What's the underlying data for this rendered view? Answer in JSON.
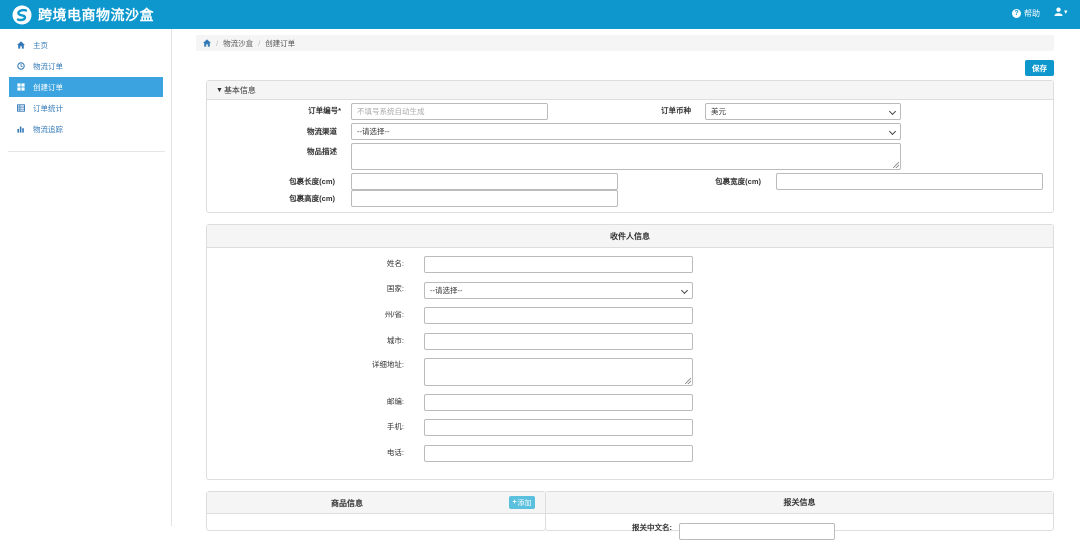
{
  "app": {
    "title": "跨境电商物流沙盒"
  },
  "header": {
    "help_label": "帮助",
    "user_caret": "▾"
  },
  "sidebar": {
    "items": [
      {
        "label": "主页"
      },
      {
        "label": "物流订单"
      },
      {
        "label": "创建订单"
      },
      {
        "label": "订单统计"
      },
      {
        "label": "物流追踪"
      }
    ]
  },
  "breadcrumb": {
    "level1": "物流沙盒",
    "level2": "创建订单",
    "separator": "/"
  },
  "toolbar": {
    "save_label": "保存"
  },
  "basic": {
    "title": "基本信息",
    "order_no_label": "订单编号*",
    "order_no_placeholder": "不填号系统自动生成",
    "currency_label": "订单币种",
    "currency_value": "美元",
    "channel_label": "物流渠道",
    "channel_value": "--请选择--",
    "desc_label": "物品描述",
    "length_label": "包裹长度(cm)",
    "width_label": "包裹宽度(cm)",
    "height_label": "包裹高度(cm)"
  },
  "recipient": {
    "title": "收件人信息",
    "name_label": "姓名:",
    "country_label": "国家:",
    "country_value": "--请选择--",
    "state_label": "州/省:",
    "city_label": "城市:",
    "address_label": "详细地址:",
    "zip_label": "邮编:",
    "mobile_label": "手机:",
    "phone_label": "电话:"
  },
  "goods": {
    "title": "商品信息",
    "add_label": "添加",
    "add_symbol": "+"
  },
  "customs": {
    "title": "报关信息",
    "partial_label": "报关中文名:"
  },
  "colors": {
    "primary": "#0d97cd",
    "sidebar_active": "#3ba3e0",
    "link": "#337ab7",
    "add_button": "#5bc0de"
  }
}
